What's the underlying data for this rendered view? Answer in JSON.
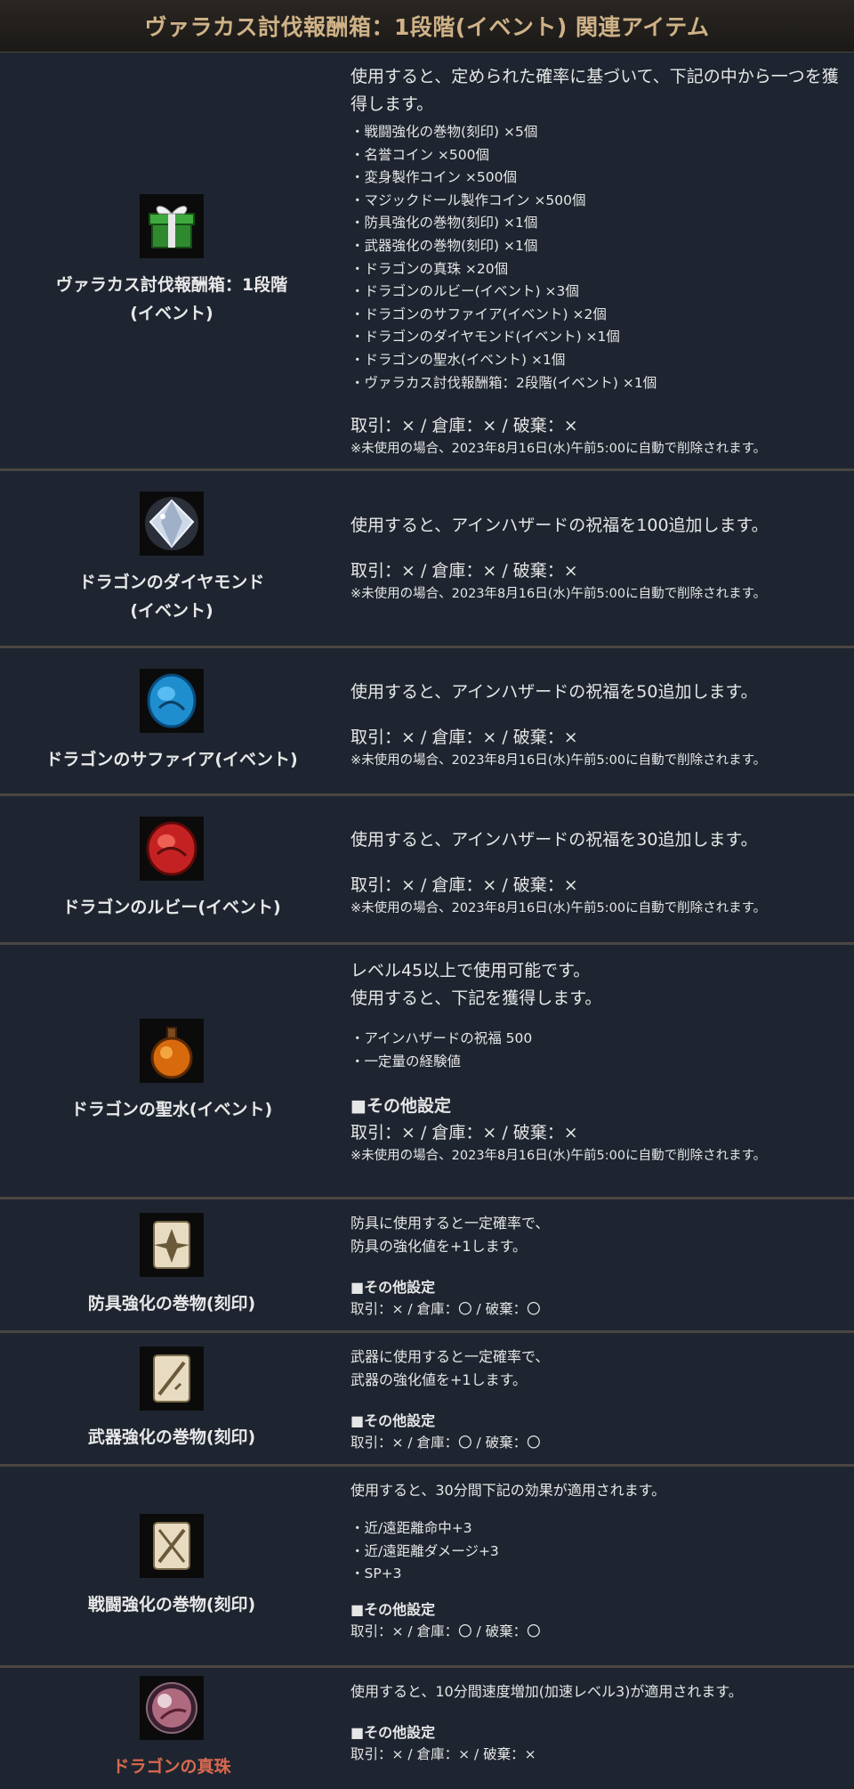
{
  "header": {
    "title": "ヴァラカス討伐報酬箱：1段階(イベント) 関連アイテム"
  },
  "rows": [
    {
      "name": "ヴァラカス討伐報酬箱：1段階\n(イベント)",
      "icon": "gift-box-icon",
      "desc": "使用すると、定められた確率に基づいて、下記の中から一つを獲得します。",
      "items": [
        "・戦闘強化の巻物(刻印) ×5個",
        "・名誉コイン ×500個",
        "・変身製作コイン ×500個",
        "・マジックドール製作コイン ×500個",
        "・防具強化の巻物(刻印) ×1個",
        "・武器強化の巻物(刻印) ×1個",
        "・ドラゴンの真珠 ×20個",
        "・ドラゴンのルビー(イベント) ×3個",
        "・ドラゴンのサファイア(イベント) ×2個",
        "・ドラゴンのダイヤモンド(イベント) ×1個",
        "・ドラゴンの聖水(イベント) ×1個",
        "・ヴァラカス討伐報酬箱：2段階(イベント) ×1個"
      ],
      "trade": "取引：× / 倉庫：× / 破棄：×",
      "note": "※未使用の場合、2023年8月16日(水)午前5:00に自動で削除されます。"
    },
    {
      "name": "ドラゴンのダイヤモンド\n(イベント)",
      "icon": "diamond-icon",
      "desc": "使用すると、アインハザードの祝福を100追加します。",
      "trade": "取引：× / 倉庫：× / 破棄：×",
      "note": "※未使用の場合、2023年8月16日(水)午前5:00に自動で削除されます。"
    },
    {
      "name": "ドラゴンのサファイア(イベント)",
      "icon": "sapphire-icon",
      "desc": "使用すると、アインハザードの祝福を50追加します。",
      "trade": "取引：× / 倉庫：× / 破棄：×",
      "note": "※未使用の場合、2023年8月16日(水)午前5:00に自動で削除されます。"
    },
    {
      "name": "ドラゴンのルビー(イベント)",
      "icon": "ruby-icon",
      "desc": "使用すると、アインハザードの祝福を30追加します。",
      "trade": "取引：× / 倉庫：× / 破棄：×",
      "note": "※未使用の場合、2023年8月16日(水)午前5:00に自動で削除されます。"
    },
    {
      "name": "ドラゴンの聖水(イベント)",
      "icon": "holy-water-icon",
      "desc": "レベル45以上で使用可能です。\n使用すると、下記を獲得します。",
      "items": [
        "・アインハザードの祝福 500",
        "・一定量の経験値"
      ],
      "section": "■その他設定",
      "trade": "取引：× / 倉庫：× / 破棄：×",
      "note": "※未使用の場合、2023年8月16日(水)午前5:00に自動で削除されます。"
    },
    {
      "name": "防具強化の巻物(刻印)",
      "icon": "armor-scroll-icon",
      "desc": "防具に使用すると一定確率で、\n防具の強化値を+1します。",
      "section": "■その他設定",
      "trade": "取引：× / 倉庫：〇 / 破棄：〇"
    },
    {
      "name": "武器強化の巻物(刻印)",
      "icon": "weapon-scroll-icon",
      "desc": "武器に使用すると一定確率で、\n武器の強化値を+1します。",
      "section": "■その他設定",
      "trade": "取引：× / 倉庫：〇 / 破棄：〇"
    },
    {
      "name": "戦闘強化の巻物(刻印)",
      "icon": "battle-scroll-icon",
      "desc": "使用すると、30分間下記の効果が適用されます。",
      "items": [
        "・近/遠距離命中+3",
        "・近/遠距離ダメージ+3",
        "・SP+3"
      ],
      "section": "■その他設定",
      "trade": "取引：× / 倉庫：〇 / 破棄：〇"
    },
    {
      "name": "ドラゴンの真珠",
      "icon": "pearl-icon",
      "desc": "使用すると、10分間速度増加(加速レベル3)が適用されます。",
      "section": "■その他設定",
      "trade": "取引：× / 倉庫：× / 破棄：×"
    }
  ]
}
